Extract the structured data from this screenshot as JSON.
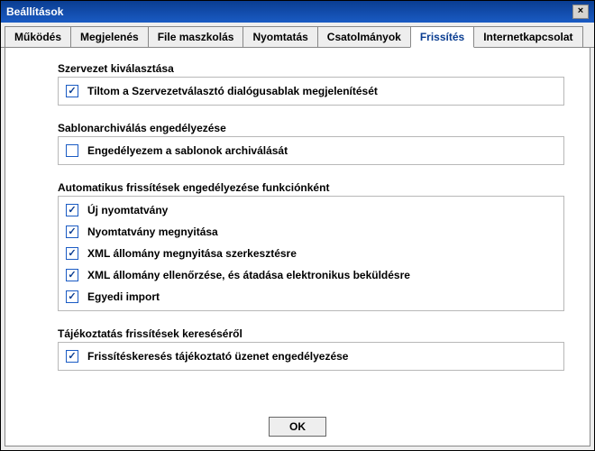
{
  "window": {
    "title": "Beállítások"
  },
  "tabs": [
    {
      "label": "Működés"
    },
    {
      "label": "Megjelenés"
    },
    {
      "label": "File maszkolás"
    },
    {
      "label": "Nyomtatás"
    },
    {
      "label": "Csatolmányok"
    },
    {
      "label": "Frissítés"
    },
    {
      "label": "Internetkapcsolat"
    }
  ],
  "groups": {
    "org": {
      "title": "Szervezet kiválasztása",
      "items": [
        {
          "label": "Tiltom a Szervezetválasztó dialógusablak megjelenítését",
          "checked": true
        }
      ]
    },
    "template": {
      "title": "Sablonarchiválás engedélyezése",
      "items": [
        {
          "label": "Engedélyezem a sablonok archiválását",
          "checked": false
        }
      ]
    },
    "auto": {
      "title": "Automatikus frissítések engedélyezése funkciónként",
      "items": [
        {
          "label": "Új nyomtatvány",
          "checked": true
        },
        {
          "label": "Nyomtatvány megnyitása",
          "checked": true
        },
        {
          "label": "XML állomány megnyitása szerkesztésre",
          "checked": true
        },
        {
          "label": "XML állomány ellenőrzése, és átadása elektronikus beküldésre",
          "checked": true
        },
        {
          "label": "Egyedi import",
          "checked": true
        }
      ]
    },
    "notify": {
      "title": "Tájékoztatás frissítések kereséséről",
      "items": [
        {
          "label": "Frissítéskeresés tájékoztató üzenet engedélyezése",
          "checked": true
        }
      ]
    }
  },
  "buttons": {
    "ok": "OK",
    "close": "×"
  }
}
